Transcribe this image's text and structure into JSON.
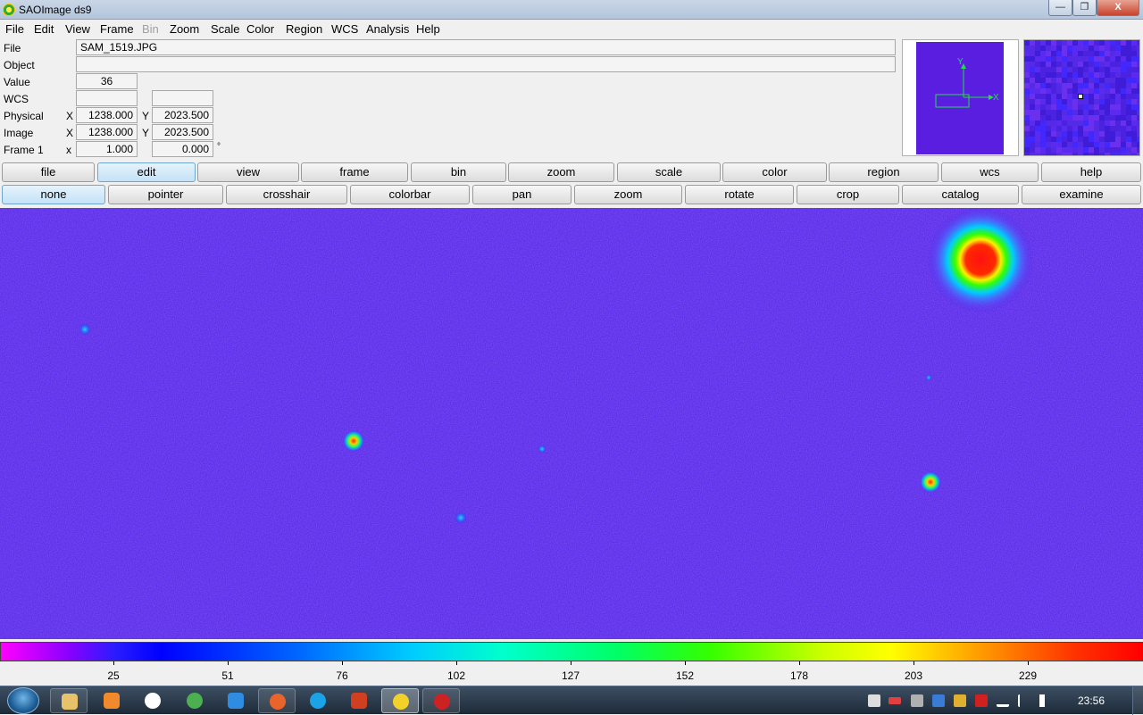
{
  "window": {
    "title": "SAOImage ds9",
    "minimize": "—",
    "maximize": "❐",
    "close": "X"
  },
  "menu": [
    "File",
    "Edit",
    "View",
    "Frame",
    "Bin",
    "Zoom",
    "Scale",
    "Color",
    "Region",
    "WCS",
    "Analysis",
    "Help"
  ],
  "menu_disabled": [
    "Bin"
  ],
  "info": {
    "file_label": "File",
    "file_value": "SAM_1519.JPG",
    "object_label": "Object",
    "object_value": "",
    "value_label": "Value",
    "value_value": "36",
    "wcs_label": "WCS",
    "wcs_value1": "",
    "wcs_value2": "",
    "physical_label": "Physical",
    "physical_x_axis": "X",
    "physical_x": "1238.000",
    "physical_y_axis": "Y",
    "physical_y": "2023.500",
    "image_label": "Image",
    "image_x_axis": "X",
    "image_x": "1238.000",
    "image_y_axis": "Y",
    "image_y": "2023.500",
    "frame_label": "Frame 1",
    "frame_x_axis": "x",
    "frame_zoom": "1.000",
    "frame_angle": "0.000",
    "frame_angle_unit": "°"
  },
  "panner": {
    "y_axis": "Y",
    "x_axis": "X",
    "compass_color": "#22dd44"
  },
  "buttonbar_main": [
    "file",
    "edit",
    "view",
    "frame",
    "bin",
    "zoom",
    "scale",
    "color",
    "region",
    "wcs",
    "help"
  ],
  "buttonbar_main_active": "edit",
  "buttonbar_edit": [
    "none",
    "pointer",
    "crosshair",
    "colorbar",
    "pan",
    "zoom",
    "rotate",
    "crop",
    "catalog",
    "examine"
  ],
  "buttonbar_edit_active": "none",
  "colorbar": {
    "ticks": [
      "25",
      "51",
      "76",
      "102",
      "127",
      "152",
      "178",
      "203",
      "229"
    ]
  },
  "colors": {
    "background": "#4f1fe6",
    "active_button": "#c3e2f7"
  },
  "taskbar": {
    "apps": [
      {
        "name": "windows-explorer",
        "color": "#e8c26a"
      },
      {
        "name": "media-player",
        "color": "#f08a2a"
      },
      {
        "name": "panda-antivirus",
        "color": "#ffffff"
      },
      {
        "name": "chrome",
        "color": "#4caf50"
      },
      {
        "name": "internet-explorer",
        "color": "#2e8de0"
      },
      {
        "name": "firefox",
        "color": "#e8642a"
      },
      {
        "name": "skype",
        "color": "#1aa3e6"
      },
      {
        "name": "game-app",
        "color": "#d04020"
      },
      {
        "name": "ds9",
        "color": "#f2d22a"
      },
      {
        "name": "record-app",
        "color": "#cc2222"
      }
    ],
    "clock": "23:56"
  }
}
